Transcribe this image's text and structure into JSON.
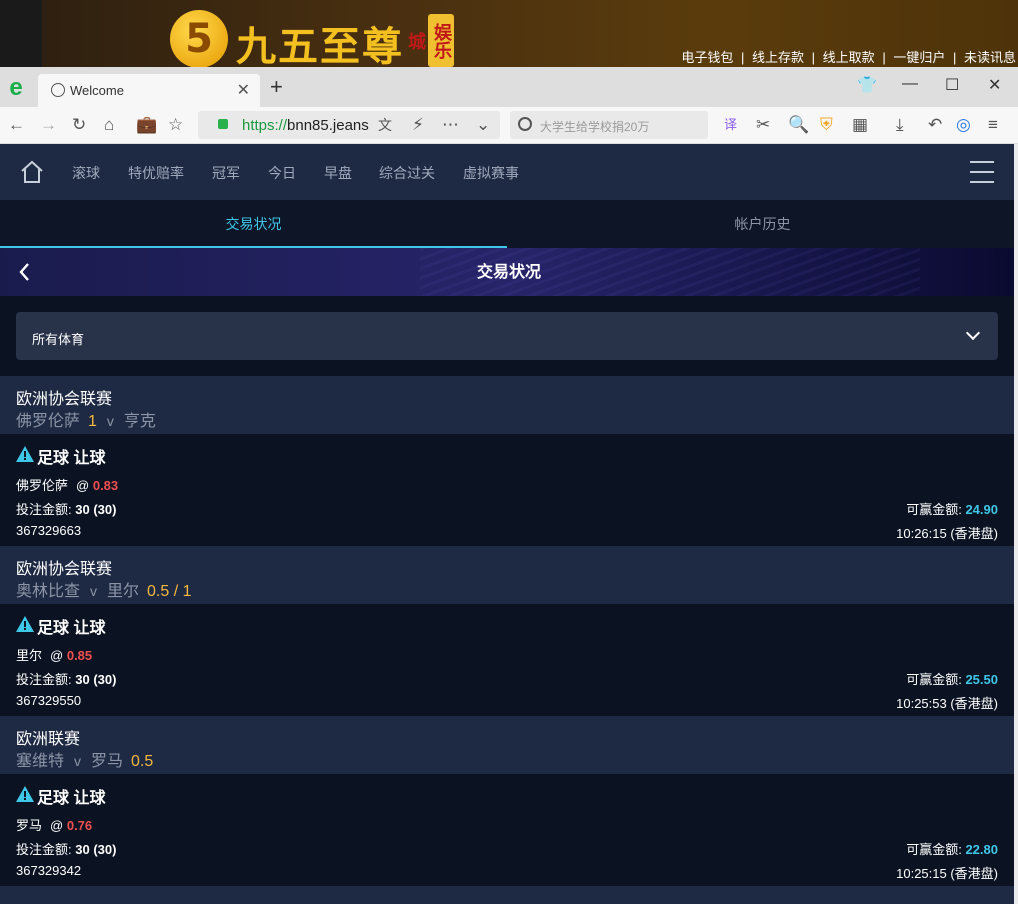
{
  "banner": {
    "logo_char": "5",
    "logo_text": "九五至尊",
    "logo_tag": "娱乐城",
    "links": [
      "电子钱包",
      "线上存款",
      "线上取款",
      "一键归户",
      "未读讯息"
    ],
    "separator": "|"
  },
  "browser": {
    "tab_title": "Welcome",
    "url_scheme": "https://",
    "url_rest": "bnn85.jeans",
    "search_placeholder": "大学生给学校捐20万"
  },
  "site_nav": {
    "items": [
      "滚球",
      "特优赔率",
      "冠军",
      "今日",
      "早盘",
      "综合过关",
      "虚拟赛事"
    ]
  },
  "tabs": {
    "trade": "交易状况",
    "history": "帐户历史"
  },
  "hero_title": "交易状况",
  "filter": {
    "value": "所有体育"
  },
  "bets": [
    {
      "league": "欧洲协会联赛",
      "home": "佛罗伦萨",
      "handicap_home": "1",
      "vs": "v",
      "away": "亨克",
      "handicap_away": "",
      "sport": "足球 让球",
      "pick": "佛罗伦萨",
      "at": "@",
      "odds": "0.83",
      "stake_label": "投注金额:",
      "stake": "30 (30)",
      "win_label": "可赢金额:",
      "win": "24.90",
      "id": "367329663",
      "time": "10:26:15 (香港盘)"
    },
    {
      "league": "欧洲协会联赛",
      "home": "奥林比查",
      "handicap_home": "",
      "vs": "v",
      "away": "里尔",
      "handicap_away": "0.5 / 1",
      "sport": "足球 让球",
      "pick": "里尔",
      "at": "@",
      "odds": "0.85",
      "stake_label": "投注金额:",
      "stake": "30 (30)",
      "win_label": "可赢金额:",
      "win": "25.50",
      "id": "367329550",
      "time": "10:25:53 (香港盘)"
    },
    {
      "league": "欧洲联赛",
      "home": "塞维特",
      "handicap_home": "",
      "vs": "v",
      "away": "罗马",
      "handicap_away": "0.5",
      "sport": "足球 让球",
      "pick": "罗马",
      "at": "@",
      "odds": "0.76",
      "stake_label": "投注金额:",
      "stake": "30 (30)",
      "win_label": "可赢金额:",
      "win": "22.80",
      "id": "367329342",
      "time": "10:25:15 (香港盘)"
    }
  ],
  "colors": {
    "accent": "#3fc7e8",
    "odds": "#ee5050",
    "handicap": "#f5b73c",
    "header_bg": "#1e2a44",
    "body_bg": "#0b1322"
  }
}
